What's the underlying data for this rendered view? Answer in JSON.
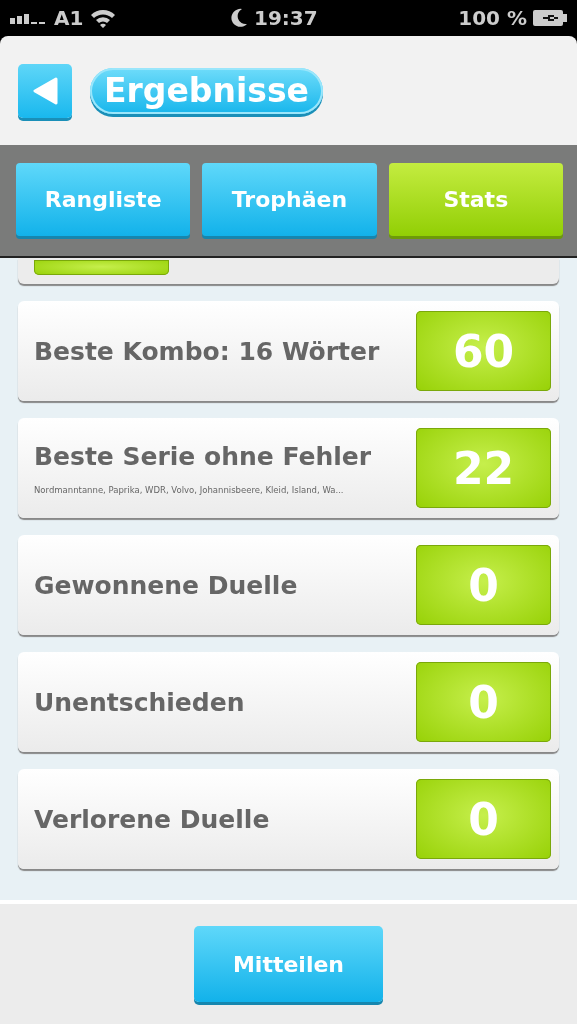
{
  "status_bar": {
    "carrier": "A1",
    "time": "19:37",
    "battery": "100 %"
  },
  "header": {
    "title": "Ergebnisse"
  },
  "tabs": [
    {
      "label": "Rangliste",
      "selected": false
    },
    {
      "label": "Trophäen",
      "selected": false
    },
    {
      "label": "Stats",
      "selected": true
    }
  ],
  "stats": [
    {
      "label": "Beste Kombo: 16 Wörter",
      "value": "60"
    },
    {
      "label": "Beste Serie ohne Fehler",
      "detail": "Nordmanntanne, Paprika, WDR, Volvo, Johannisbeere, Kleid, Island, Wa...",
      "value": "22"
    },
    {
      "label": "Gewonnene Duelle",
      "value": "0"
    },
    {
      "label": "Unentschieden",
      "value": "0"
    },
    {
      "label": "Verlorene Duelle",
      "value": "0"
    }
  ],
  "share_button": "Mitteilen"
}
